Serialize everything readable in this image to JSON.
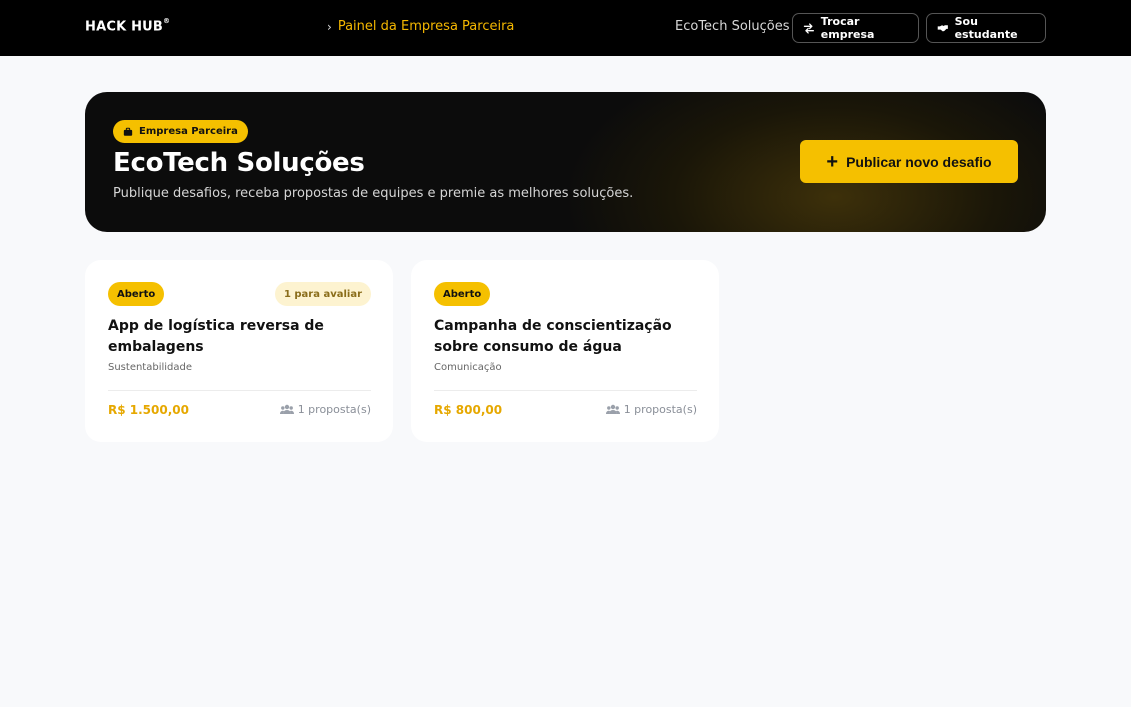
{
  "header": {
    "logo": "HACK HUB",
    "logo_mark": "®",
    "breadcrumb": "Painel da Empresa Parceira",
    "company": "EcoTech Soluções",
    "switch_button": "Trocar empresa",
    "student_button": "Sou estudante"
  },
  "hero": {
    "badge": "Empresa Parceira",
    "title": "EcoTech Soluções",
    "subtitle": "Publique desafios, receba propostas de equipes e premie as melhores soluções.",
    "publish_button": "Publicar novo desafio"
  },
  "challenges": [
    {
      "status": "Aberto",
      "pending": "1 para avaliar",
      "title": "App de logística reversa de embalagens",
      "category": "Sustentabilidade",
      "prize": "R$ 1.500,00",
      "proposals": "1 proposta(s)"
    },
    {
      "status": "Aberto",
      "title": "Campanha de conscientização sobre consumo de água",
      "category": "Comunicação",
      "prize": "R$ 800,00",
      "proposals": "1 proposta(s)"
    }
  ],
  "colors": {
    "accent": "#f5c000",
    "prize": "#e6a800",
    "topbar": "#000000"
  },
  "icons": {
    "breadcrumb": "chevron-right-icon",
    "switch": "swap-arrows-icon",
    "student": "handshake-icon",
    "badge": "briefcase-icon",
    "publish": "plus-icon",
    "proposals": "users-icon"
  }
}
